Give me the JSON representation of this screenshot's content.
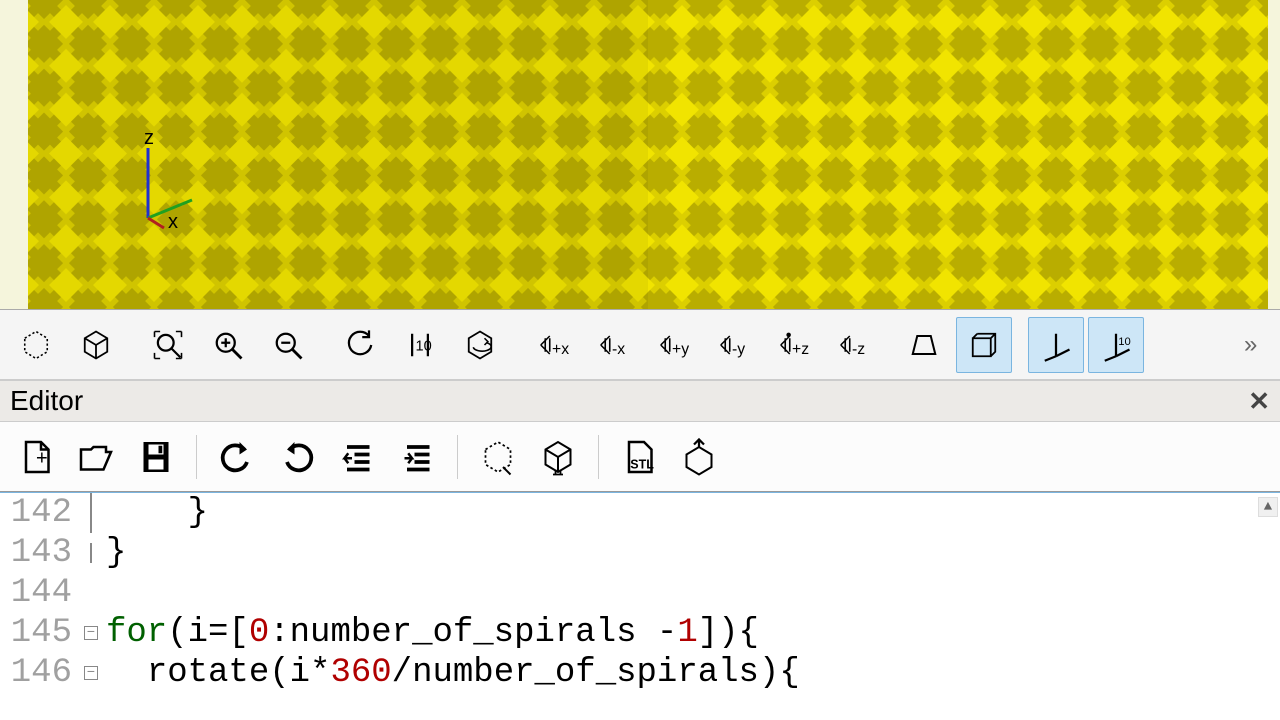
{
  "axes": {
    "x_label": "x",
    "y_label": "",
    "z_label": "z"
  },
  "view_toolbar": {
    "preview_icon": "preview",
    "render_icon": "render",
    "zoom_fit": "zoom-fit",
    "zoom_in": "zoom-in",
    "zoom_out": "zoom-out",
    "rotate_reset": "rotate-reset",
    "view_align": "view-align",
    "view_diag": "view-diag",
    "x_plus": "+x",
    "x_minus": "-x",
    "y_plus": "+y",
    "y_minus": "-y",
    "z_plus": "+z",
    "z_minus": "-z",
    "persp": "perspective",
    "ortho": "orthogonal",
    "axes_toggle": "show-axes",
    "axes_scale": "scale-axes"
  },
  "editor_panel": {
    "title": "Editor",
    "close": "✕"
  },
  "editor_toolbar": {
    "new": "new-file",
    "open": "open-file",
    "save": "save-file",
    "undo": "undo",
    "redo": "redo",
    "unindent": "unindent",
    "indent": "indent",
    "preview": "preview",
    "render": "render",
    "export_stl": "STL",
    "send_printer": "send-to-printer"
  },
  "code": {
    "lines": [
      {
        "num": "142",
        "fold": "bar",
        "indent": "    ",
        "text": "}"
      },
      {
        "num": "143",
        "fold": "end",
        "indent": "",
        "text": "}"
      },
      {
        "num": "144",
        "fold": "",
        "indent": "",
        "text": ""
      },
      {
        "num": "145",
        "fold": "minus",
        "indent": "",
        "kw": "for",
        "text": "(i=[",
        "num_a": "0",
        "mid": ":number_of_spirals -",
        "num_b": "1",
        "tail": "]){"
      },
      {
        "num": "146",
        "fold": "minus",
        "indent": "  ",
        "fn": "rotate",
        "text": "(i*",
        "num_a": "360",
        "mid": "/number_of_spirals){",
        "num_b": "",
        "tail": ""
      }
    ]
  }
}
